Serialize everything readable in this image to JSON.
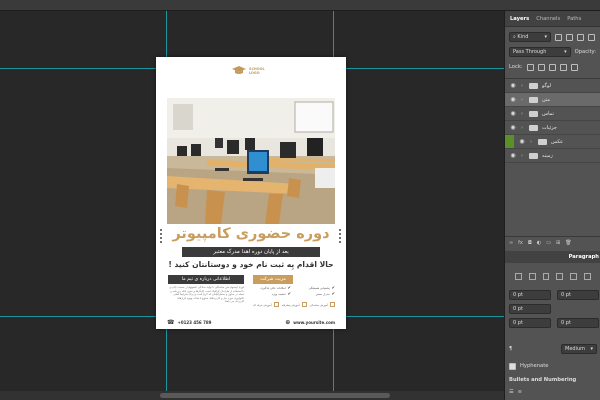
{
  "document": {
    "logo_line1": "SCHOOL",
    "logo_line2": "LOGO",
    "title": "دوره حضوری کامپیوتر",
    "subtitle": "بعد از پایان دوره اهدا مدرک معتبر",
    "cta": "حالا اقدام بِه ثبت نام خود و دوستانتان کنید !",
    "info_label": "اطلاعاتی درباره ی تیم ما",
    "benefits_label": "مزیت شرکت",
    "paragraph": "لورم ایپسوم متن ساختگی با تولید سادگی نامفهوم از صنعت چاپ و با استفاده از طراحان گرافیک است چاپگرها و متون بلکه روزنامه و مجله در ستون و سطرآنچنان که لازم است و برای شرایط فعلی تکنولوژی مورد نیاز و کاربردهای متنوع با هدف بهبود ابزارهای کاربردی می باشد",
    "features": [
      "امکانات عالی یادگیری",
      "پشتیبانی همیشگی",
      "تخفیف ویژه",
      "مدرک معتبر"
    ],
    "icon_labels": [
      "آموزش حرفه ای",
      "آموزش پیشرفته",
      "آموزش مقدماتی"
    ],
    "phone": "+0123 456 789",
    "website": "www.yoursite.com"
  },
  "panel": {
    "tabs": [
      "Layers",
      "Channels",
      "Paths"
    ],
    "kind_label": "Kind",
    "blend_mode": "Pass Through",
    "opacity_label": "Opacity:",
    "lock_label": "Lock:",
    "layers": [
      {
        "name": "لوگو",
        "visible": true,
        "selected": false
      },
      {
        "name": "متن",
        "visible": true,
        "selected": true
      },
      {
        "name": "تماس",
        "visible": true,
        "selected": false
      },
      {
        "name": "جزئیات",
        "visible": true,
        "selected": false
      },
      {
        "name": "عکس",
        "visible": true,
        "selected": false
      },
      {
        "name": "زمینه",
        "visible": true,
        "selected": false
      }
    ],
    "paragraph_tab": "Paragraph",
    "indent_values": [
      "0 pt",
      "0 pt",
      "0 pt",
      "0 pt",
      "0 pt"
    ],
    "medium_label": "Medium",
    "hyphenate_label": "Hyphenate",
    "bullets_label": "Bullets and Numbering"
  },
  "colors": {
    "accent_gold": "#c99d5e",
    "dark_bar": "#3b3b3b",
    "guide": "#18b9c8",
    "layer_active_green": "#5b8f2a"
  }
}
